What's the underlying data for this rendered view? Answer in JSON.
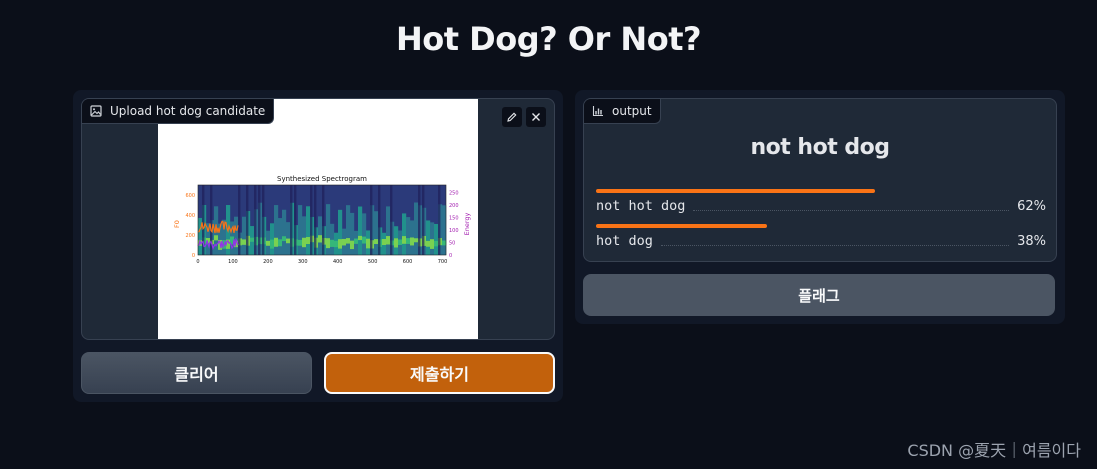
{
  "app": {
    "title": "Hot Dog? Or Not?"
  },
  "input": {
    "label": "Upload hot dog candidate",
    "icons": [
      "image-icon",
      "edit-icon",
      "close-icon"
    ],
    "spectrogram": {
      "title": "Synthesized Spectrogram",
      "left_axis_label": "F0",
      "right_axis_label": "Energy",
      "x_ticks": [
        "0",
        "100",
        "200",
        "300",
        "400",
        "500",
        "600",
        "700"
      ],
      "left_ticks": [
        "0",
        "200",
        "400",
        "600"
      ],
      "right_ticks": [
        "0",
        "50",
        "100",
        "150",
        "200",
        "250"
      ]
    }
  },
  "buttons": {
    "clear": "클리어",
    "submit": "제출하기",
    "flag": "플래그"
  },
  "output": {
    "label": "output",
    "prediction": "not hot dog",
    "confidences": [
      {
        "label": "not hot dog",
        "value": 0.62,
        "display": "62%"
      },
      {
        "label": "hot dog",
        "value": 0.38,
        "display": "38%"
      }
    ]
  },
  "colors": {
    "accent": "#f97316",
    "submit_bg": "#c2610c",
    "background": "#0b0f19",
    "panel": "#111827"
  },
  "watermark": "CSDN @夏天｜여름이다"
}
